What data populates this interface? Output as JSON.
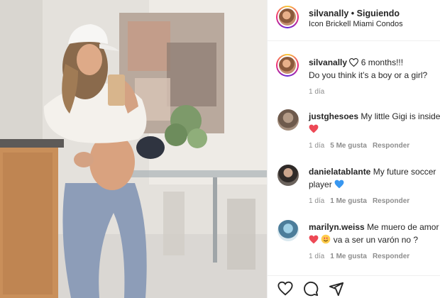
{
  "post": {
    "username": "silvanally",
    "separator": "•",
    "follow_label": "Siguiendo",
    "location": "Icon Brickell Miami Condos"
  },
  "caption": {
    "username": "silvanally",
    "line1": "6 months!!!",
    "line2": "Do you think it’s a boy or a girl?",
    "time": "1 día"
  },
  "comments": [
    {
      "username": "justghesoes",
      "text": "My little Gigi is inside",
      "time": "1 día",
      "likes": "5 Me gusta",
      "reply": "Responder"
    },
    {
      "username": "danielatablante",
      "text": "My future soccer",
      "text2": "player",
      "time": "1 día",
      "likes": "1 Me gusta",
      "reply": "Responder"
    },
    {
      "username": "marilyn.weiss",
      "text": "Me muero de amor",
      "text2": "va a ser un varón no ?",
      "time": "1 día",
      "likes": "1 Me gusta",
      "reply": "Responder"
    }
  ],
  "colors": {
    "red_heart": "#ed4956",
    "blue_heart": "#3897f0",
    "meta_gray": "#8e8e8e",
    "text": "#262626"
  },
  "icons": [
    "more-icon",
    "heart-icon",
    "comment-icon",
    "share-icon"
  ]
}
